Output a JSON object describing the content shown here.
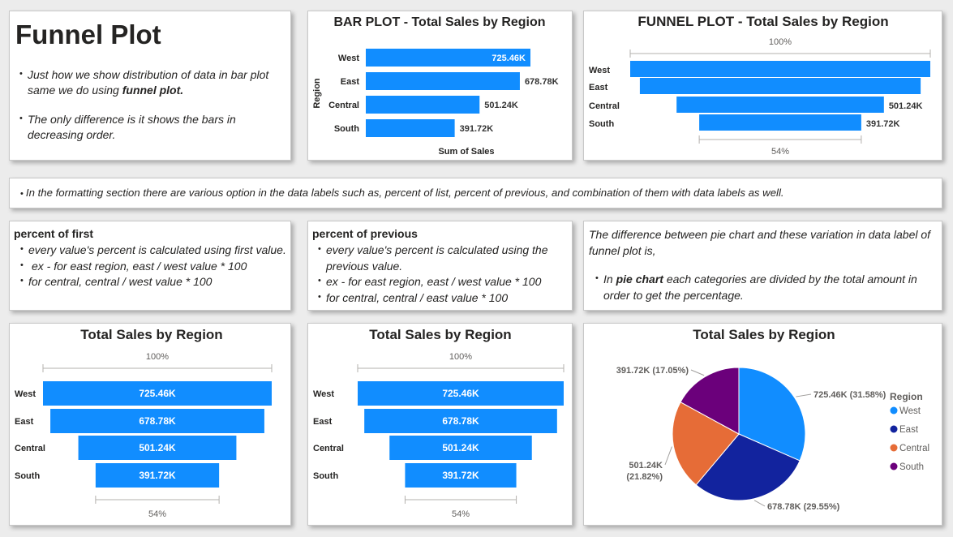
{
  "intro": {
    "title": "Funnel Plot",
    "bullet1_text": "Just how we show distribution of data in bar plot same we do using ",
    "bullet1_bold": "funnel plot.",
    "bullet2": "The only difference is it shows the bars in decreasing order."
  },
  "note": {
    "text": "In the formatting section there are various option in the data labels such as, percent of list, percent of previous, and combination of them with data labels as well."
  },
  "percent_first": {
    "heading": "percent of first",
    "items": [
      "every value's percent is calculated using first value.",
      "ex - for east region, east / west value * 100",
      "for central, central / west value * 100"
    ]
  },
  "percent_previous": {
    "heading": "percent of previous",
    "items": [
      "every value's percent is calculated using the previous value.",
      "ex - for east region, east / west value * 100",
      "for central, central / east value * 100"
    ]
  },
  "pie_note": {
    "intro": "The difference between pie chart and these variation in data label of funnel plot is,",
    "bullet_pre": "In ",
    "bullet_bold": "pie chart",
    "bullet_post": " each categories are divided by the total amount in order to get the percentage."
  },
  "colors": {
    "bar": "#118dff",
    "west": "#118dff",
    "east": "#12239e",
    "central": "#e66c37",
    "south": "#6b007b"
  },
  "chart_data": [
    {
      "id": "bar",
      "type": "bar",
      "title": "BAR PLOT - Total Sales by Region",
      "xlabel": "Sum of Sales",
      "ylabel": "Region",
      "categories": [
        "West",
        "East",
        "Central",
        "South"
      ],
      "values": [
        725.46,
        678.78,
        501.24,
        391.72
      ],
      "data_labels": [
        "725.46K",
        "678.78K",
        "501.24K",
        "391.72K"
      ]
    },
    {
      "id": "funnel_top",
      "type": "funnel",
      "title": "FUNNEL PLOT - Total Sales by Region",
      "top_pct": "100%",
      "bottom_pct": "54%",
      "categories": [
        "West",
        "East",
        "Central",
        "South"
      ],
      "values": [
        725.46,
        678.78,
        501.24,
        391.72
      ],
      "data_labels": [
        "",
        "",
        "501.24K",
        "391.72K"
      ]
    },
    {
      "id": "funnel_first",
      "type": "funnel",
      "title": "Total Sales by Region",
      "top_pct": "100%",
      "bottom_pct": "54%",
      "categories": [
        "West",
        "East",
        "Central",
        "South"
      ],
      "values": [
        725.46,
        678.78,
        501.24,
        391.72
      ],
      "data_labels": [
        "725.46K",
        "678.78K",
        "501.24K",
        "391.72K"
      ]
    },
    {
      "id": "funnel_prev",
      "type": "funnel",
      "title": "Total Sales by Region",
      "top_pct": "100%",
      "bottom_pct": "54%",
      "categories": [
        "West",
        "East",
        "Central",
        "South"
      ],
      "values": [
        725.46,
        678.78,
        501.24,
        391.72
      ],
      "data_labels": [
        "725.46K",
        "678.78K",
        "501.24K",
        "391.72K"
      ]
    },
    {
      "id": "pie",
      "type": "pie",
      "title": "Total Sales by Region",
      "legend_title": "Region",
      "legend_position": "right",
      "categories": [
        "West",
        "East",
        "Central",
        "South"
      ],
      "values": [
        725.46,
        678.78,
        501.24,
        391.72
      ],
      "percents": [
        31.58,
        29.55,
        21.82,
        17.05
      ],
      "data_labels": [
        "725.46K (31.58%)",
        "678.78K (29.55%)",
        "501.24K (21.82%)",
        "391.72K (17.05%)"
      ]
    }
  ]
}
